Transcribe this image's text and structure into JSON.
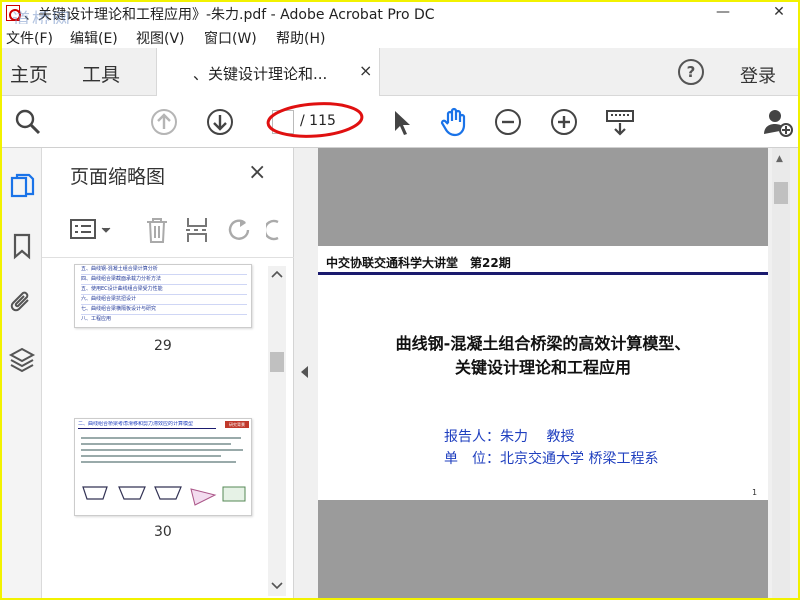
{
  "window": {
    "title": "、关键设计理论和工程应用》-朱力.pdf - Adobe Acrobat Pro DC",
    "watermark": "道桥网",
    "minimize": "—",
    "close": "✕"
  },
  "menu": [
    "文件(F)",
    "编辑(E)",
    "视图(V)",
    "窗口(W)",
    "帮助(H)"
  ],
  "tabs": {
    "home": "主页",
    "tools": "工具",
    "doc": "、关键设计理论和...",
    "doc_close": "×",
    "login": "登录",
    "help": "?"
  },
  "toolbar": {
    "page_current": "",
    "page_total": "/ 115",
    "annotation_color": "#e01010"
  },
  "thumbnails": {
    "title": "页面缩略图",
    "close": "×",
    "pages": [
      {
        "number": "29",
        "lines": [
          "五、曲线钢-混凝土组合梁计算分析",
          "四、曲线组合梁截面承载力分析方法",
          "五、使用EC设计曲线组合梁受力性能",
          "六、曲线组合梁抗扭设计",
          "七、曲线组合梁横隔板设计与研究",
          "八、工程应用"
        ]
      },
      {
        "number": "30",
        "heading": "二、曲线组合桥梁考虑滑移和剪力滞效应的计算模型",
        "tag": "研究背景"
      }
    ]
  },
  "document": {
    "header": "中交协联交通科学大讲堂　第22期",
    "title_line1": "曲线钢-混凝土组合桥梁的高效计算模型、",
    "title_line2": "关键设计理论和工程应用",
    "reporter": "报告人：朱力　 教授",
    "unit": "单　位：北京交通大学 桥梁工程系",
    "page_number": "1"
  },
  "colors": {
    "accent_blue": "#1f3fbf",
    "hand_tool": "#1a73e8",
    "screen_border": "#f2f200"
  }
}
